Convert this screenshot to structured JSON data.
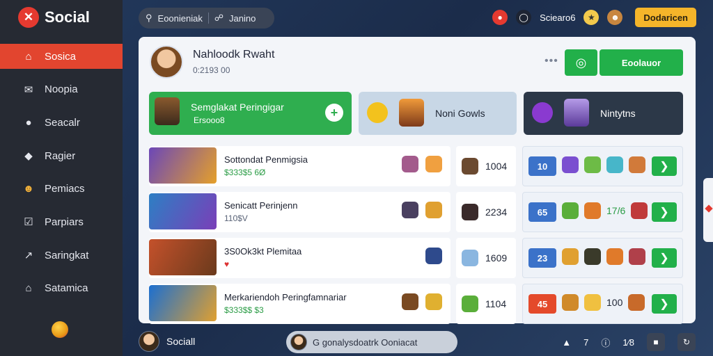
{
  "app": {
    "name": "Social",
    "logo_glyph": "✕"
  },
  "sidebar": {
    "items": [
      {
        "label": "Sosica",
        "icon": "home-icon",
        "glyph": "⌂"
      },
      {
        "label": "Noopia",
        "icon": "mail-icon",
        "glyph": "✉"
      },
      {
        "label": "Seacalr",
        "icon": "user-icon",
        "glyph": "●"
      },
      {
        "label": "Ragier",
        "icon": "diamond-icon",
        "glyph": "◆"
      },
      {
        "label": "Pemiacs",
        "icon": "character-icon",
        "glyph": "☻"
      },
      {
        "label": "Parpiars",
        "icon": "checkbox-icon",
        "glyph": "☑"
      },
      {
        "label": "Saringkat",
        "icon": "chart-icon",
        "glyph": "↗"
      },
      {
        "label": "Satamica",
        "icon": "house-icon",
        "glyph": "⌂"
      }
    ],
    "active_index": 0
  },
  "topbar": {
    "search_label": "Eoonieniak",
    "search_icon": "search-icon",
    "filter_label": "Janino",
    "filter_icon": "shield-icon",
    "status_text": "Sciearo6",
    "button_label": "Dodaricen",
    "accent": "#f5b52a"
  },
  "profile": {
    "name": "Nahloodk Rwaht",
    "sub": "0:2193 00"
  },
  "actions": {
    "more": "•••",
    "primary_label": "Eoolauor",
    "icon_glyph": "◎"
  },
  "cards": [
    {
      "title": "Semglakat Peringigar",
      "sub": "Ersooo8",
      "color": "#2fae4f"
    },
    {
      "title": "Noni Gowls",
      "color": "#c8d7e6"
    },
    {
      "title": "Nintytns",
      "color": "#2c3848"
    }
  ],
  "rows": [
    {
      "title": "Sottondat Penmigsia",
      "sub": "$333$5 6Ø",
      "count": "1004",
      "badge": "10",
      "badge_color": "#3b72c9",
      "team_num": "",
      "thumb": "#6b47b8"
    },
    {
      "title": "Senicatt Perinjenn",
      "sub": "110$V",
      "count": "2234",
      "badge": "65",
      "badge_color": "#3b72c9",
      "team_num": "17/6",
      "thumb": "#2d7fc4"
    },
    {
      "title": "3S0Ok3kt Plemitaa",
      "sub": "♥",
      "count": "1609",
      "badge": "23",
      "badge_color": "#3b72c9",
      "team_num": "",
      "thumb": "#c4512b"
    },
    {
      "title": "Merkariendoh Peringfamnariar",
      "sub": "$333$$ $3",
      "count": "1104",
      "badge": "45",
      "badge_color": "#e44a2b",
      "team_num": "100",
      "thumb": "#1c6fd0"
    }
  ],
  "bottom": {
    "user": "Sociall",
    "chat_text": "G gonalysdoatrk Ooniacat",
    "right_items": [
      "▲",
      "7",
      "ⓘ",
      "1⁄8"
    ]
  }
}
